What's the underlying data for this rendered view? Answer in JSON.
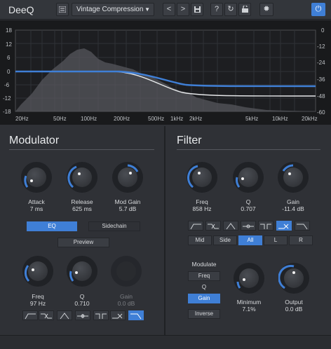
{
  "app": {
    "title": "DeeQ"
  },
  "toolbar": {
    "preset": "Vintage Compression",
    "prev": "<",
    "next": ">",
    "help": "?"
  },
  "graph": {
    "y_left": [
      "18",
      "12",
      "6",
      "0",
      "-6",
      "-12",
      "-18"
    ],
    "y_right": [
      "0",
      "-12",
      "-24",
      "-36",
      "-48",
      "-60"
    ],
    "x": [
      "20Hz",
      "50Hz",
      "100Hz",
      "200Hz",
      "500Hz",
      "1kHz",
      "2kHz",
      "5kHz",
      "10kHz",
      "20kHz"
    ]
  },
  "modulator": {
    "title": "Modulator",
    "attack": {
      "label": "Attack",
      "value": "7 ms"
    },
    "release": {
      "label": "Release",
      "value": "625 ms"
    },
    "mod_gain": {
      "label": "Mod Gain",
      "value": "5.7 dB"
    },
    "eq_label": "EQ",
    "sidechain_label": "Sidechain",
    "preview_label": "Preview",
    "freq": {
      "label": "Freq",
      "value": "97 Hz"
    },
    "q": {
      "label": "Q",
      "value": "0.710"
    },
    "gain": {
      "label": "Gain",
      "value": "0.0 dB"
    }
  },
  "filter": {
    "title": "Filter",
    "freq": {
      "label": "Freq",
      "value": "858 Hz"
    },
    "q": {
      "label": "Q",
      "value": "0.707"
    },
    "gain": {
      "label": "Gain",
      "value": "-11.4 dB"
    },
    "channels": [
      "Mid",
      "Side",
      "All",
      "L",
      "R"
    ],
    "modulate_label": "Modulate",
    "modulate_options": [
      "Freq",
      "Q",
      "Gain"
    ],
    "inverse_label": "Inverse",
    "minimum": {
      "label": "Minimum",
      "value": "7.1%"
    },
    "output": {
      "label": "Output",
      "value": "0.0 dB"
    }
  },
  "colors": {
    "accent": "#3f7fd6",
    "bg": "#2f3136",
    "graph_bg": "#191a1c"
  }
}
